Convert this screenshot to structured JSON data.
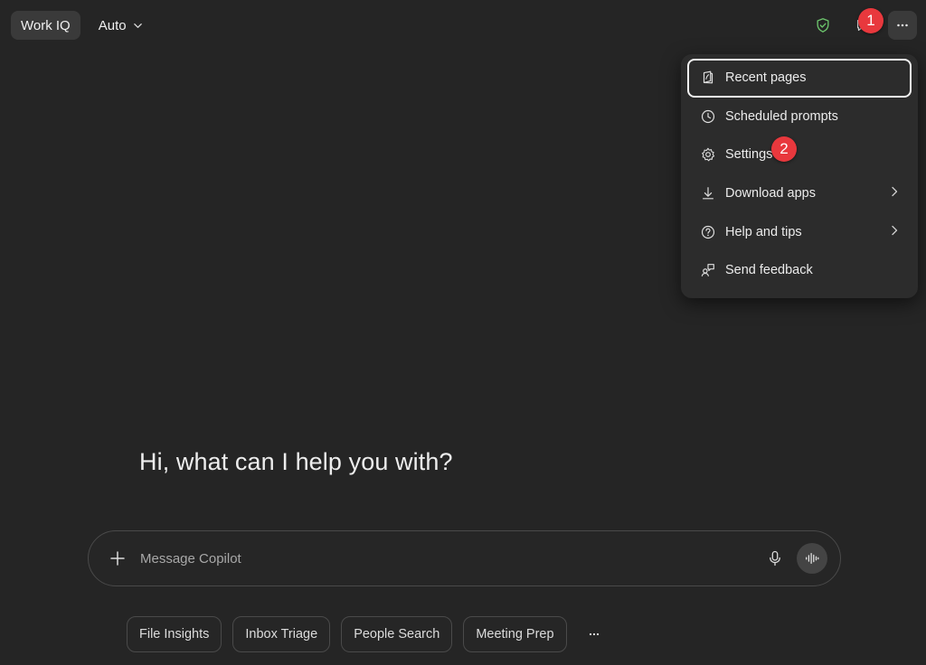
{
  "header": {
    "workiq_label": "Work IQ",
    "mode_label": "Auto"
  },
  "badges": {
    "first": "1",
    "second": "2"
  },
  "menu": {
    "items": [
      {
        "label": "Recent pages",
        "icon": "book-icon"
      },
      {
        "label": "Scheduled prompts",
        "icon": "clock-icon"
      },
      {
        "label": "Settings",
        "icon": "gear-icon"
      },
      {
        "label": "Download apps",
        "icon": "download-icon"
      },
      {
        "label": "Help and tips",
        "icon": "help-icon"
      },
      {
        "label": "Send feedback",
        "icon": "feedback-icon"
      }
    ]
  },
  "greeting": "Hi, what can I help you with?",
  "composer": {
    "placeholder": "Message Copilot"
  },
  "chips": [
    "File Insights",
    "Inbox Triage",
    "People Search",
    "Meeting Prep"
  ],
  "colors": {
    "background": "#252525",
    "shield": "#6cc46c",
    "badge": "#e8383d"
  }
}
